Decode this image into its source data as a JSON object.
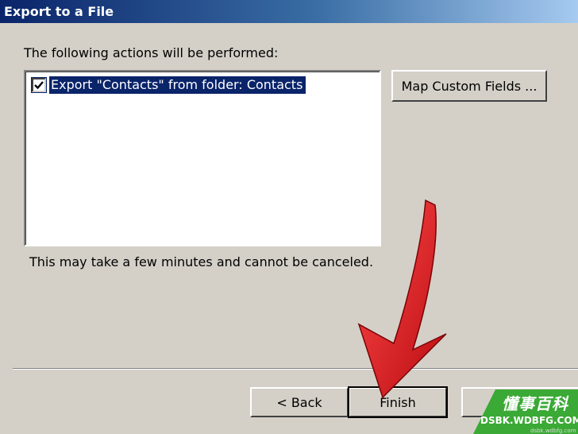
{
  "window": {
    "title": "Export to a File"
  },
  "content": {
    "actions_label": "The following actions will be performed:",
    "actions": [
      {
        "label": "Export \"Contacts\" from folder: Contacts",
        "checked": true
      }
    ],
    "map_fields_button": "Map Custom Fields ...",
    "note": "This may take a few minutes and cannot be canceled."
  },
  "buttons": {
    "back": "< Back",
    "finish": "Finish",
    "cancel": ""
  },
  "annotation": {
    "arrow_color": "#e8141c"
  },
  "watermark": {
    "title": "懂事百科",
    "site": "DSBK.WDBFG.COM",
    "small": "dsbk.wdbfg.com",
    "color": "#3aa935"
  },
  "colors": {
    "titlebar_start": "#0a246a",
    "titlebar_end": "#a6caf0",
    "dialog_bg": "#d4d0c8",
    "selection": "#0a246a"
  }
}
